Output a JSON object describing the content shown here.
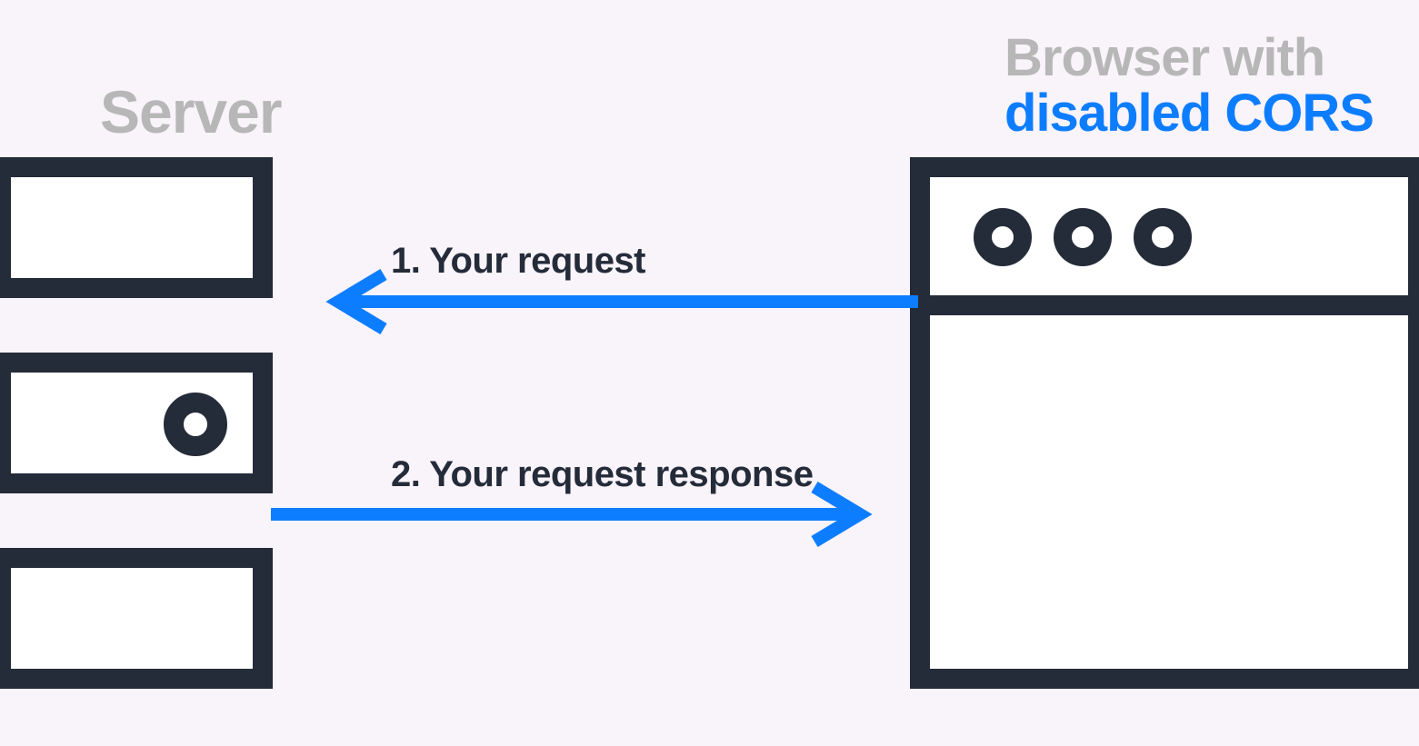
{
  "server": {
    "title": "Server"
  },
  "browser": {
    "title_line1": "Browser with",
    "title_line2": "disabled CORS"
  },
  "arrows": {
    "request_label": "1. Your request",
    "response_label": "2. Your request response"
  },
  "colors": {
    "outline": "#242b39",
    "arrow": "#0d7dff",
    "muted": "#b7b7b7",
    "bg": "#f9f3fa"
  }
}
